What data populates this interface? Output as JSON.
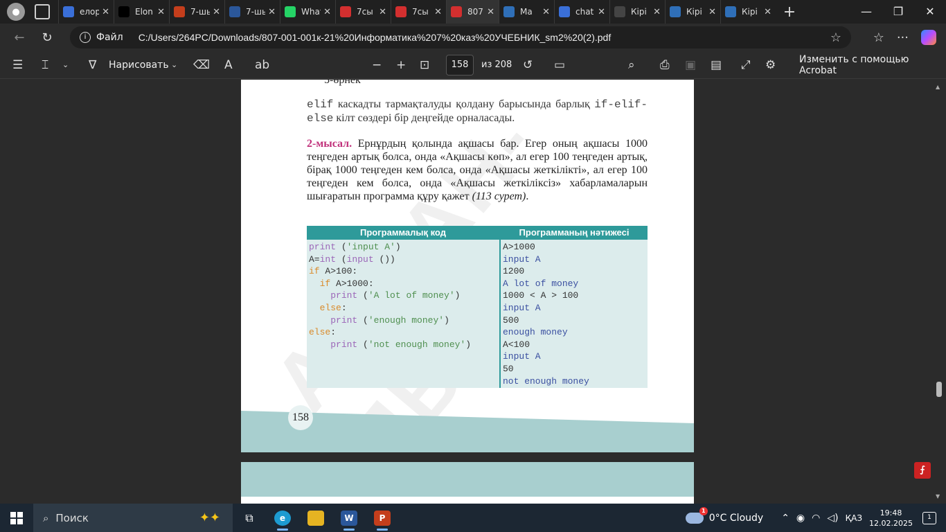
{
  "tabs": [
    {
      "title": "елорда",
      "icon": "search-icon",
      "color": "#3a6fd8"
    },
    {
      "title": "Elon",
      "icon": "x-logo-icon",
      "color": "#000000"
    },
    {
      "title": "7-шы",
      "icon": "powerpoint-icon",
      "color": "#c43e1c"
    },
    {
      "title": "7-шы",
      "icon": "word-icon",
      "color": "#2b579a"
    },
    {
      "title": "WhatsApp",
      "icon": "whatsapp-icon",
      "color": "#25d366"
    },
    {
      "title": "7сы",
      "icon": "pdf-icon",
      "color": "#d32f2f"
    },
    {
      "title": "7сы",
      "icon": "pdf-icon",
      "color": "#d32f2f"
    },
    {
      "title": "807",
      "icon": "pdf-icon",
      "color": "#d32f2f",
      "active": true
    },
    {
      "title": "Ма",
      "icon": "grid-icon",
      "color": "#2f6fb8"
    },
    {
      "title": "chat",
      "icon": "search-icon",
      "color": "#3a6fd8"
    },
    {
      "title": "Кірі",
      "icon": "openai-icon",
      "color": "#444444"
    },
    {
      "title": "Кірі",
      "icon": "grid-icon",
      "color": "#2f6fb8"
    },
    {
      "title": "Кірі",
      "icon": "grid-icon",
      "color": "#2f6fb8"
    }
  ],
  "address": {
    "file_label": "Файл",
    "url": "C:/Users/264PC/Downloads/807-001-001к-21%20Информатика%207%20каз%20УЧЕБНИК_sm2%20(2).pdf"
  },
  "pdf_toolbar": {
    "draw_label": "Нарисовать",
    "page_current": "158",
    "page_total": "из 208",
    "acrobat_label": "Изменить с помощью Acrobat"
  },
  "page": {
    "header": "5-өрнек",
    "para1_code1": "elif",
    "para1_text1": " каскадты тармақталуды қолдану барысында барлық ",
    "para1_code2": "if-elif-else",
    "para1_text2": " кілт сөздері бір деңгейде орналасады.",
    "example_label": "2-мысал.",
    "example_text": " Ернұрдың қолында ақшасы бар. Егер оның ақшасы 1000 теңгеден артық болса, онда «Ақшасы көп», ал егер 100 теңгеден артық, бірақ 1000 теңгеден кем болса, онда «Ақшасы жеткілікті», ал егер 100 теңгеден кем болса, онда «Ақшасы жеткіліксіз» хабарламаларын шығаратын программа құру қажет ",
    "example_ref": "(113 сурет)",
    "example_end": ".",
    "table_head_code": "Программалық код",
    "table_head_result": "Программаның нәтижесі",
    "page_number": "158"
  },
  "code_lines": [
    [
      {
        "t": "print",
        "c": "fn"
      },
      {
        "t": " (",
        "c": ""
      },
      {
        "t": "'input A'",
        "c": "str"
      },
      {
        "t": ")",
        "c": ""
      }
    ],
    [
      {
        "t": "A=",
        "c": ""
      },
      {
        "t": "int",
        "c": "fn"
      },
      {
        "t": " (",
        "c": ""
      },
      {
        "t": "input",
        "c": "fn"
      },
      {
        "t": " ())",
        "c": ""
      }
    ],
    [
      {
        "t": "if",
        "c": "kw"
      },
      {
        "t": " A>100:",
        "c": ""
      }
    ],
    [
      {
        "t": "  ",
        "c": ""
      },
      {
        "t": "if",
        "c": "kw"
      },
      {
        "t": " A>1000:",
        "c": ""
      }
    ],
    [
      {
        "t": "    ",
        "c": ""
      },
      {
        "t": "print",
        "c": "fn"
      },
      {
        "t": " (",
        "c": ""
      },
      {
        "t": "'A lot of money'",
        "c": "str"
      },
      {
        "t": ")",
        "c": ""
      }
    ],
    [
      {
        "t": "  ",
        "c": ""
      },
      {
        "t": "else",
        "c": "kw"
      },
      {
        "t": ":",
        "c": ""
      }
    ],
    [
      {
        "t": "    ",
        "c": ""
      },
      {
        "t": "print",
        "c": "fn"
      },
      {
        "t": " (",
        "c": ""
      },
      {
        "t": "'enough money'",
        "c": "str"
      },
      {
        "t": ")",
        "c": ""
      }
    ],
    [
      {
        "t": "else",
        "c": "kw"
      },
      {
        "t": ":",
        "c": ""
      }
    ],
    [
      {
        "t": "    ",
        "c": ""
      },
      {
        "t": "print",
        "c": "fn"
      },
      {
        "t": " (",
        "c": ""
      },
      {
        "t": "'not enough money'",
        "c": "str"
      },
      {
        "t": ")",
        "c": ""
      }
    ]
  ],
  "output_lines": [
    {
      "t": "A>1000",
      "c": "s"
    },
    {
      "t": "input A",
      "c": "u"
    },
    {
      "t": "1200",
      "c": "s"
    },
    {
      "t": "A lot of money",
      "c": "u"
    },
    {
      "t": "1000 < A > 100",
      "c": "s"
    },
    {
      "t": "input A",
      "c": "u"
    },
    {
      "t": "500",
      "c": "s"
    },
    {
      "t": "enough money",
      "c": "u"
    },
    {
      "t": "A<100",
      "c": "s"
    },
    {
      "t": "input A",
      "c": "u"
    },
    {
      "t": "50",
      "c": "s"
    },
    {
      "t": "not enough money",
      "c": "u"
    }
  ],
  "taskbar": {
    "search_label": "Поиск",
    "weather_badge": "1",
    "weather": "0°C  Cloudy",
    "language": "ҚАЗ",
    "time": "19:48",
    "date": "12.02.2025",
    "notification_count": "1"
  }
}
